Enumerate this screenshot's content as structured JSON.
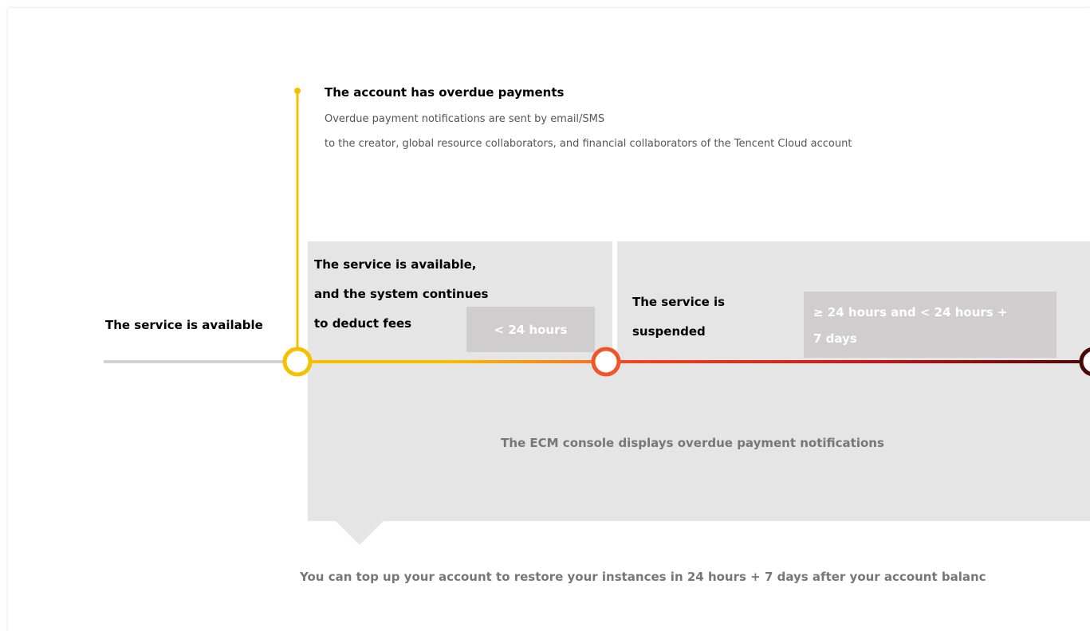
{
  "overdue": {
    "title": "The account has overdue payments",
    "line1": "Overdue payment notifications are sent by email/SMS",
    "line2": "to the creator, global resource collaborators, and financial collaborators of the Tencent Cloud account"
  },
  "stages": {
    "available": "The service is available",
    "available_deducting": [
      "The service is available,",
      "and the system continues",
      "to deduct fees"
    ],
    "suspended": [
      "The service is",
      "suspended"
    ]
  },
  "durations": {
    "short": "< 24 hours",
    "long": [
      "≥ 24 hours and < 24 hours +",
      "7 days"
    ]
  },
  "notes": {
    "console": "The ECM console displays overdue payment notifications",
    "restore": "You can top up your account to restore your instances in 24 hours + 7 days after your account balanc"
  },
  "colors": {
    "gray_line": "#d2d2d2",
    "yellow": "#f5c000",
    "orange": "#f36b2a",
    "red": "#d92525",
    "dark_red": "#4a0808",
    "block_gray": "#e5e5e5",
    "duration_gray": "#cfcdcd"
  }
}
